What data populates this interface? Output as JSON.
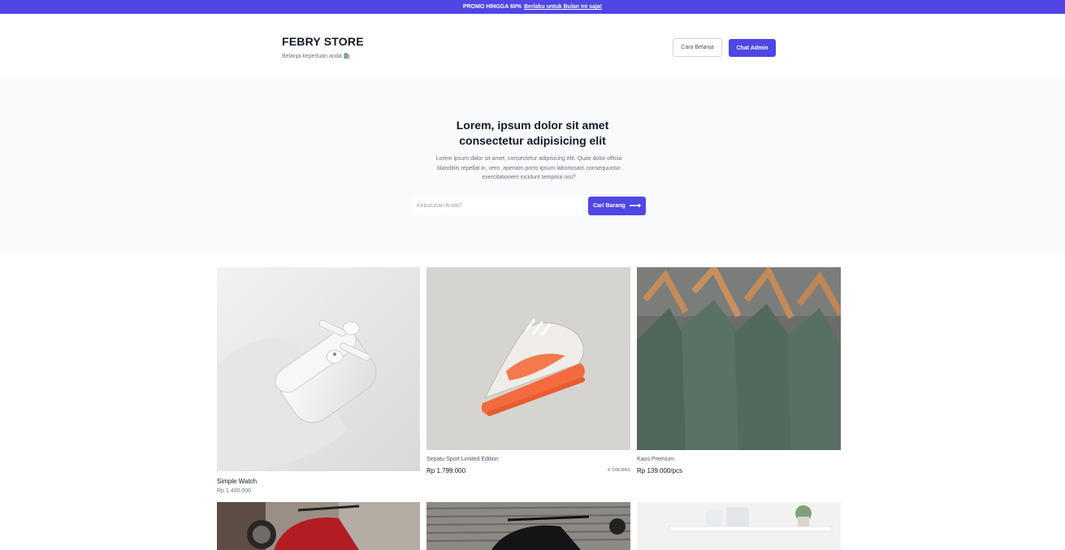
{
  "promo": {
    "text": "PROMO HINGGA 60%",
    "link": "Berlaku untuk Bulan ini saja!"
  },
  "brand": {
    "title": "FEBRY STORE",
    "subtitle": "Belanja keperluan anda 🛍️"
  },
  "header": {
    "guide_button": "Cara Belanja",
    "chat_button": "Chat Admin"
  },
  "hero": {
    "title_line1": "Lorem, ipsum dolor sit amet",
    "title_line2": "consectetur adipisicing elit",
    "description": "Lorem ipsum dolor sit amet, consectetur adipisicing elit. Quae dolor officia blanditiis repellat in, vero, aperiam porro ipsum laboriosam consequuntur exercitationem incidunt tempora nisi?",
    "search_placeholder": "Kebutuhan Anda?",
    "search_button": "Cari Barang",
    "search_icon": "arrow-right-icon"
  },
  "products": [
    {
      "name": "Simple Watch",
      "price": "Rp 1.400.000",
      "image": "airpods-photo"
    },
    {
      "name": "Sepatu Sport Limited Edition",
      "price": "Rp 1.799.000",
      "badge": "6 COLORS",
      "image": "sneaker-photo"
    },
    {
      "name": "Kaos Premium",
      "price": "Rp 139.000/pcs",
      "image": "tshirts-on-hangers-photo"
    },
    {
      "image": "motorcycle-red-photo"
    },
    {
      "image": "motorcycle-black-photo"
    },
    {
      "image": "shelf-plants-photo"
    }
  ],
  "colors": {
    "accent": "#4f46e5",
    "hero_bg": "#f9fafb"
  }
}
